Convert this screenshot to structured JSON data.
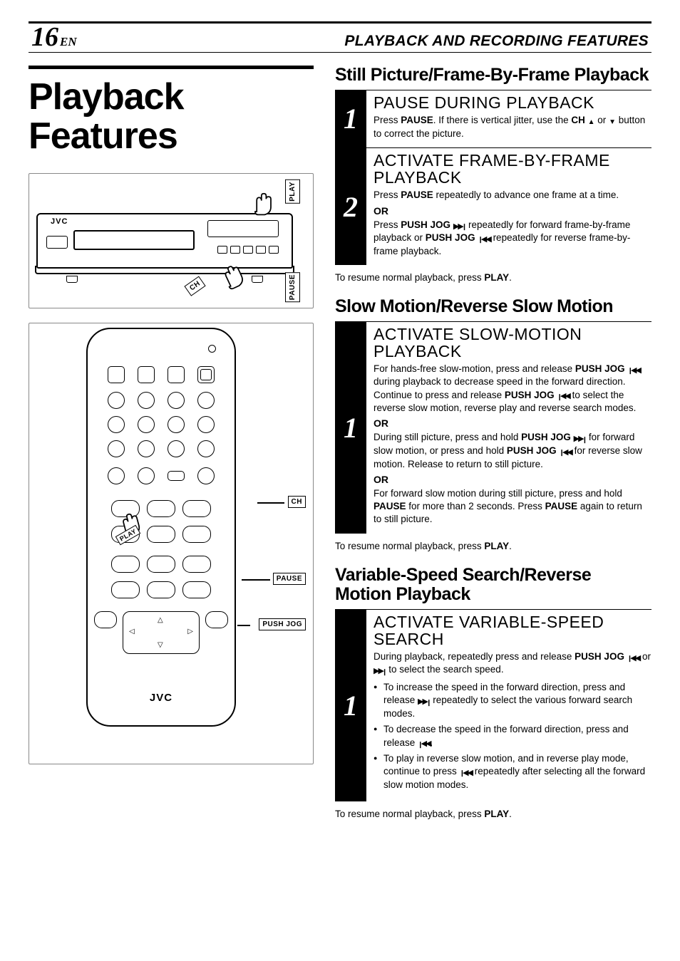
{
  "header": {
    "page_number": "16",
    "lang": "EN",
    "section": "PLAYBACK AND RECORDING FEATURES"
  },
  "main_title": "Playback Features",
  "illus": {
    "vcr_brand": "JVC",
    "remote_brand": "JVC",
    "callouts": {
      "play": "PLAY",
      "pause": "PAUSE",
      "ch": "CH",
      "push_jog": "PUSH JOG"
    }
  },
  "sections": [
    {
      "title": "Still Picture/Frame-By-Frame Playback",
      "steps": [
        {
          "num": "1",
          "title": "PAUSE DURING PLAYBACK",
          "blocks": [
            {
              "type": "p",
              "html": "Press <b>PAUSE</b>. If there is vertical jitter, use the <b>CH</b> <span class='sym tri-up'></span> or <span class='sym tri-dn'></span> button to correct the picture."
            }
          ]
        },
        {
          "num": "2",
          "title": "ACTIVATE FRAME-BY-FRAME PLAYBACK",
          "blocks": [
            {
              "type": "p",
              "html": "Press <b>PAUSE</b> repeatedly to advance one frame at a time."
            },
            {
              "type": "or"
            },
            {
              "type": "p",
              "html": "Press <b>PUSH JOG</b> <span class='sym ffwd'></span> repeatedly for forward frame-by-frame playback or <b>PUSH JOG</b> <span class='sym rrwd'></span> repeatedly for reverse frame-by-frame playback."
            }
          ]
        }
      ],
      "resume": "To resume normal playback, press <b>PLAY</b>."
    },
    {
      "title": "Slow Motion/Reverse Slow Motion",
      "steps": [
        {
          "num": "1",
          "title": "ACTIVATE SLOW-MOTION PLAYBACK",
          "blocks": [
            {
              "type": "p",
              "html": "For hands-free slow-motion, press and release <b>PUSH JOG</b> <span class='sym rrwd'></span> during playback to decrease speed in the forward direction. Continue to press and release <b>PUSH JOG</b> <span class='sym rrwd'></span> to select the reverse slow motion, reverse play and reverse search modes."
            },
            {
              "type": "or"
            },
            {
              "type": "p",
              "html": "During still picture, press and hold <b>PUSH JOG</b> <span class='sym ffwd'></span> for forward slow motion, or press and hold <b>PUSH JOG</b> <span class='sym rrwd'></span> for reverse slow motion. Release to return to still picture."
            },
            {
              "type": "or"
            },
            {
              "type": "p",
              "html": "For forward slow motion during still picture, press and hold <b>PAUSE</b> for more than 2 seconds. Press <b>PAUSE</b> again to return to still picture."
            }
          ]
        }
      ],
      "resume": "To resume normal playback, press <b>PLAY</b>."
    },
    {
      "title": "Variable-Speed Search/Reverse Motion Playback",
      "steps": [
        {
          "num": "1",
          "title": "ACTIVATE VARIABLE-SPEED SEARCH",
          "blocks": [
            {
              "type": "p",
              "html": "During playback, repeatedly press and release <b>PUSH JOG</b> <span class='sym rrwd'></span> or <span class='sym ffwd'></span> to select the search speed."
            },
            {
              "type": "ul",
              "items": [
                "To increase the speed in the forward direction, press and release <span class='sym ffwd'></span> repeatedly to select the various forward search modes.",
                "To decrease the speed in the forward direction, press and release <span class='sym rrwd'></span>.",
                "To play in reverse slow motion, and in reverse play mode, continue to press <span class='sym rrwd'></span> repeatedly after selecting all the forward slow motion modes."
              ]
            }
          ]
        }
      ],
      "resume": "To resume normal playback, press <b>PLAY</b>."
    }
  ]
}
